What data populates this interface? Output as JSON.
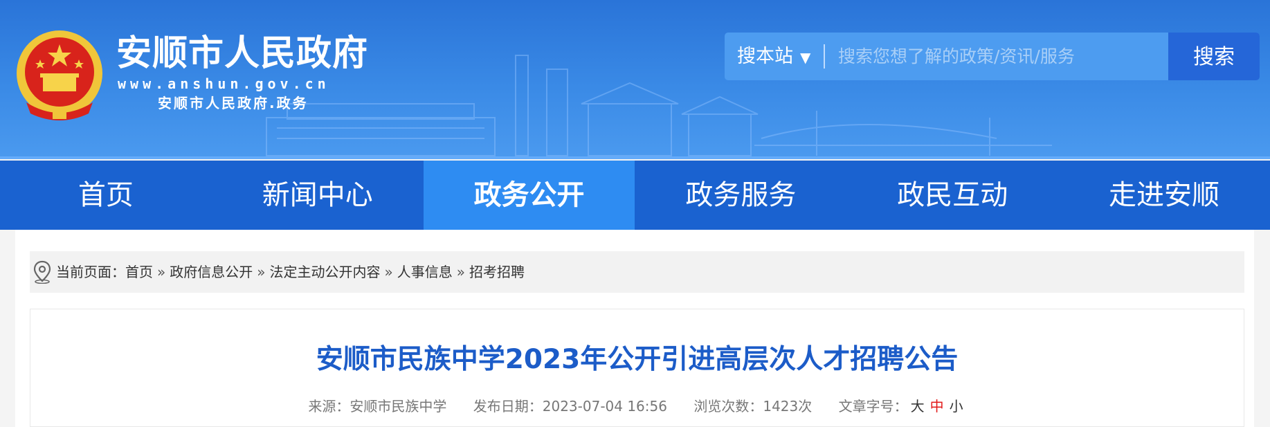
{
  "header": {
    "site_title": "安顺市人民政府",
    "site_url": "www.anshun.gov.cn",
    "site_sub": "安顺市人民政府.政务",
    "emblem_icon": "national-emblem-icon"
  },
  "search": {
    "scope_label": "搜本站",
    "scope_caret": "▼",
    "placeholder": "搜索您想了解的政策/资讯/服务",
    "button_label": "搜索"
  },
  "nav": {
    "items": [
      {
        "label": "首页"
      },
      {
        "label": "新闻中心"
      },
      {
        "label": "政务公开"
      },
      {
        "label": "政务服务"
      },
      {
        "label": "政民互动"
      },
      {
        "label": "走进安顺"
      }
    ],
    "active_index": 2
  },
  "breadcrumb": {
    "prefix": "当前页面：",
    "items": [
      "首页",
      "政府信息公开",
      "法定主动公开内容",
      "人事信息",
      "招考招聘"
    ],
    "separator": "»",
    "icon": "location-pin-icon"
  },
  "article": {
    "title": "安顺市民族中学2023年公开引进高层次人才招聘公告",
    "source": "来源：安顺市民族中学",
    "date": "发布日期：2023-07-04 16:56",
    "views": "浏览次数：1423次",
    "font_size_label": "文章字号：",
    "size_large": "大",
    "size_medium": "中",
    "size_small": "小"
  },
  "colors": {
    "header_blue": "#2a74d8",
    "nav_blue": "#1a62d0",
    "nav_active": "#2e8cf2",
    "title_blue": "#1c5cc8",
    "highlight_red": "#e21a1a"
  }
}
